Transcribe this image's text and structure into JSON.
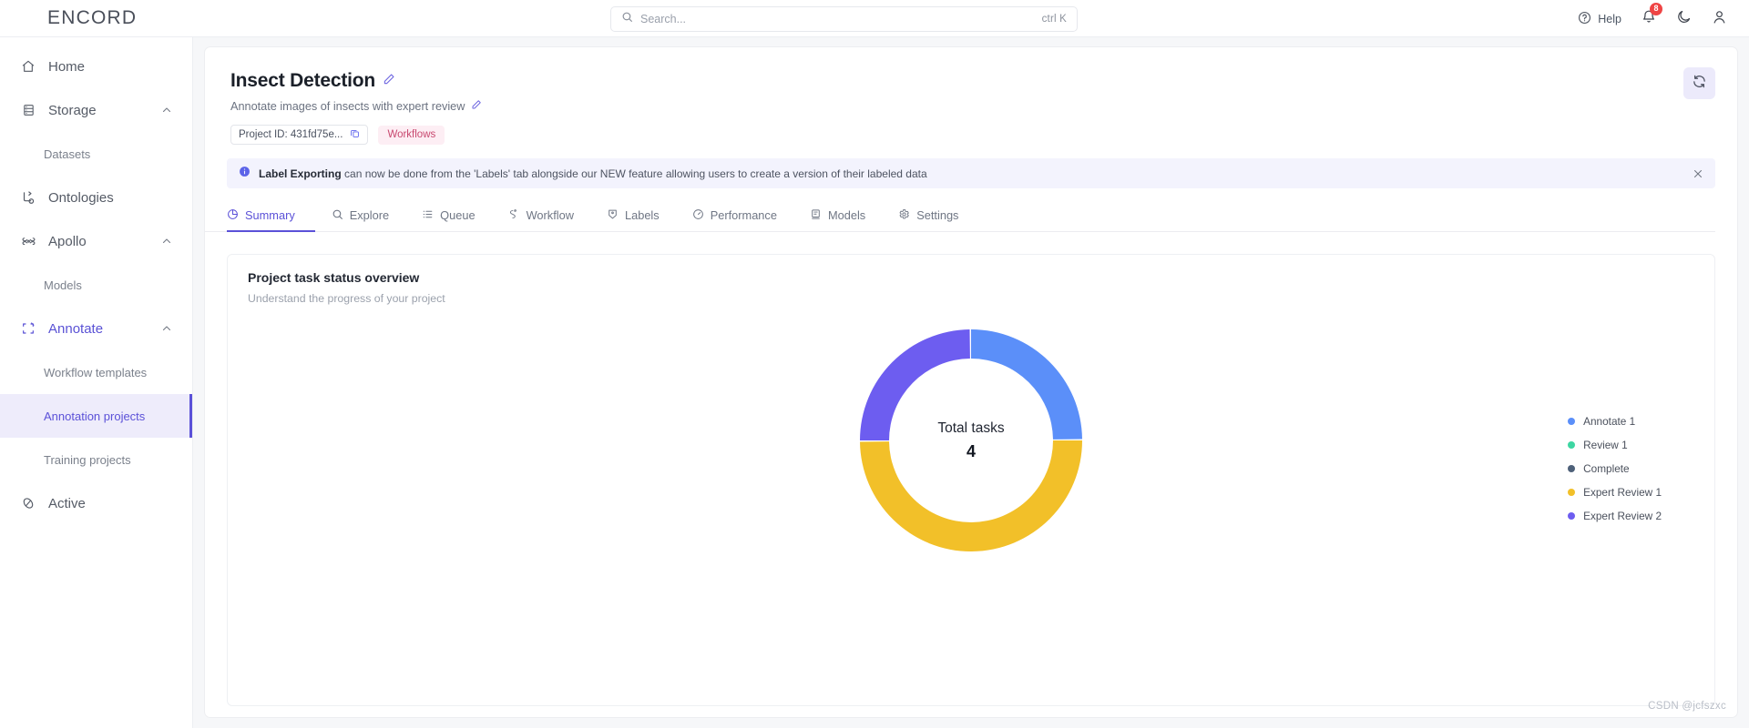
{
  "brand": {
    "name": "ENCORD"
  },
  "search": {
    "placeholder": "Search...",
    "value": "",
    "shortcut": "ctrl K",
    "icon": "search-icon"
  },
  "topbar": {
    "help_label": "Help",
    "notifications_count": "8",
    "icons": [
      "help-circle-icon",
      "bell-icon",
      "moon-icon",
      "user-icon"
    ]
  },
  "sidebar": {
    "items": [
      {
        "label": "Home",
        "icon": "home-icon",
        "type": "link"
      },
      {
        "label": "Storage",
        "icon": "storage-icon",
        "type": "group",
        "expanded": true
      },
      {
        "label": "Datasets",
        "type": "sub"
      },
      {
        "label": "Ontologies",
        "icon": "ontology-icon",
        "type": "link"
      },
      {
        "label": "Apollo",
        "icon": "apollo-icon",
        "type": "group",
        "expanded": true
      },
      {
        "label": "Models",
        "type": "sub"
      },
      {
        "label": "Annotate",
        "icon": "annotate-icon",
        "type": "group",
        "expanded": true,
        "active": true
      },
      {
        "label": "Workflow templates",
        "type": "sub"
      },
      {
        "label": "Annotation projects",
        "type": "sub",
        "selected": true
      },
      {
        "label": "Training projects",
        "type": "sub"
      },
      {
        "label": "Active",
        "icon": "active-icon",
        "type": "link"
      }
    ]
  },
  "project": {
    "title": "Insect Detection",
    "description": "Annotate images of insects with expert review",
    "project_id_label": "Project ID: 431fd75e...",
    "tag": "Workflows",
    "refresh_icon": "refresh-icon",
    "edit_icon": "pencil-icon",
    "copy_icon": "copy-icon"
  },
  "banner": {
    "bold": "Label Exporting",
    "text": " can now be done from the 'Labels' tab alongside our NEW feature allowing users to create a version of their labeled data",
    "info_icon": "info-icon",
    "close_icon": "close-icon"
  },
  "tabs": [
    {
      "label": "Summary",
      "icon": "pie-chart-icon",
      "active": true
    },
    {
      "label": "Explore",
      "icon": "search-icon",
      "active": false
    },
    {
      "label": "Queue",
      "icon": "list-icon",
      "active": false
    },
    {
      "label": "Workflow",
      "icon": "workflow-icon",
      "active": false
    },
    {
      "label": "Labels",
      "icon": "tag-icon",
      "active": false
    },
    {
      "label": "Performance",
      "icon": "gauge-icon",
      "active": false
    },
    {
      "label": "Models",
      "icon": "models-icon",
      "active": false
    },
    {
      "label": "Settings",
      "icon": "gear-icon",
      "active": false
    }
  ],
  "panel": {
    "title": "Project task status overview",
    "subtitle": "Understand the progress of your project"
  },
  "chart_data": {
    "type": "pie",
    "variant": "donut",
    "title": "Project task status overview",
    "center_label": "Total tasks",
    "center_value": "4",
    "total": 4,
    "categories": [
      "Annotate 1",
      "Review 1",
      "Complete",
      "Expert Review 1",
      "Expert Review 2"
    ],
    "values": [
      1,
      0,
      0,
      2,
      1
    ],
    "colors": [
      "#5b8ff9",
      "#3dd6a2",
      "#4e6179",
      "#f2c029",
      "#6d5df0"
    ],
    "legend_position": "right",
    "segments": [
      {
        "label": "Annotate 1",
        "value": 1,
        "color": "#5b8ff9",
        "start_deg": 0,
        "end_deg": 90
      },
      {
        "label": "Expert Review 1",
        "value": 2,
        "color": "#f2c029",
        "start_deg": 90,
        "end_deg": 270
      },
      {
        "label": "Expert Review 2",
        "value": 1,
        "color": "#6d5df0",
        "start_deg": 270,
        "end_deg": 360
      }
    ],
    "legend": [
      {
        "label": "Annotate 1",
        "color": "#5b8ff9"
      },
      {
        "label": "Review 1",
        "color": "#3dd6a2"
      },
      {
        "label": "Complete",
        "color": "#4e6179"
      },
      {
        "label": "Expert Review 1",
        "color": "#f2c029"
      },
      {
        "label": "Expert Review 2",
        "color": "#6d5df0"
      }
    ]
  },
  "watermark": "CSDN @jcfszxc",
  "theme": {
    "accent": "#5b51d8",
    "badge_red": "#ef4444",
    "tag_pink_bg": "#fdeef4",
    "tag_pink_fg": "#c8486f",
    "banner_bg": "#f3f3fd",
    "canvas_bg": "#f6f7f9"
  }
}
